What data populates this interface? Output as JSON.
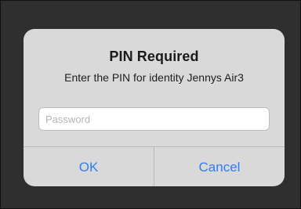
{
  "dialog": {
    "title": "PIN Required",
    "message": "Enter the PIN for identity Jennys Air3",
    "password_placeholder": "Password",
    "ok_label": "OK",
    "cancel_label": "Cancel"
  },
  "colors": {
    "backdrop": "#2f2f2f",
    "dialog_background": "#d9d9d9",
    "action_accent": "#2f7cf6",
    "divider": "#b9b9b9"
  }
}
